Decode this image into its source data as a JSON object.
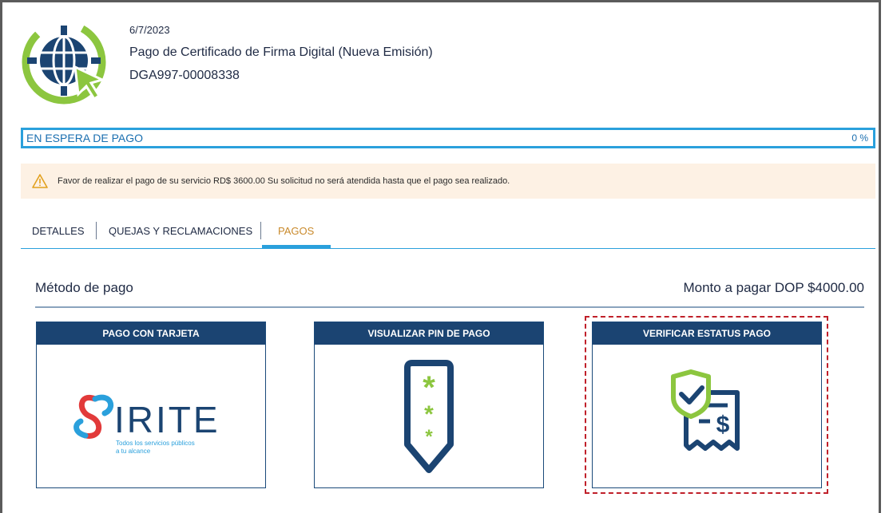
{
  "header": {
    "date": "6/7/2023",
    "title": "Pago de Certificado de Firma Digital (Nueva Emisión)",
    "code": "DGA997-00008338",
    "logo_icon": "globe-cursor-icon"
  },
  "status": {
    "label": "EN ESPERA DE PAGO",
    "progress_text": "0 %",
    "progress": 0
  },
  "alert": {
    "icon": "warning-icon",
    "message": "Favor de realizar el pago de su servicio RD$ 3600.00 Su solicitud no será atendida hasta que el pago sea realizado."
  },
  "tabs": [
    {
      "label": "DETALLES",
      "active": false
    },
    {
      "label": "QUEJAS Y RECLAMACIONES",
      "active": false
    },
    {
      "label": "PAGOS",
      "active": true
    }
  ],
  "payment": {
    "section_title": "Método de pago",
    "amount_text": "Monto a pagar DOP $4000.00",
    "cards": [
      {
        "title": "PAGO CON TARJETA",
        "logo": {
          "word": "IRITE",
          "tagline_1": "Todos los servicios públicos",
          "tagline_2": "a tu alcance"
        },
        "icon": "sirite-logo"
      },
      {
        "title": "VISUALIZAR PIN DE PAGO",
        "icon": "pin-icon"
      },
      {
        "title": "VERIFICAR ESTATUS PAGO",
        "icon": "receipt-check-icon"
      }
    ]
  },
  "colors": {
    "navy": "#1b4472",
    "accent_blue": "#2aa0dc",
    "green": "#8cc63f",
    "alert_bg": "#fdf1e4",
    "active_tab": "#c98a2c",
    "highlight": "#c0202a"
  }
}
